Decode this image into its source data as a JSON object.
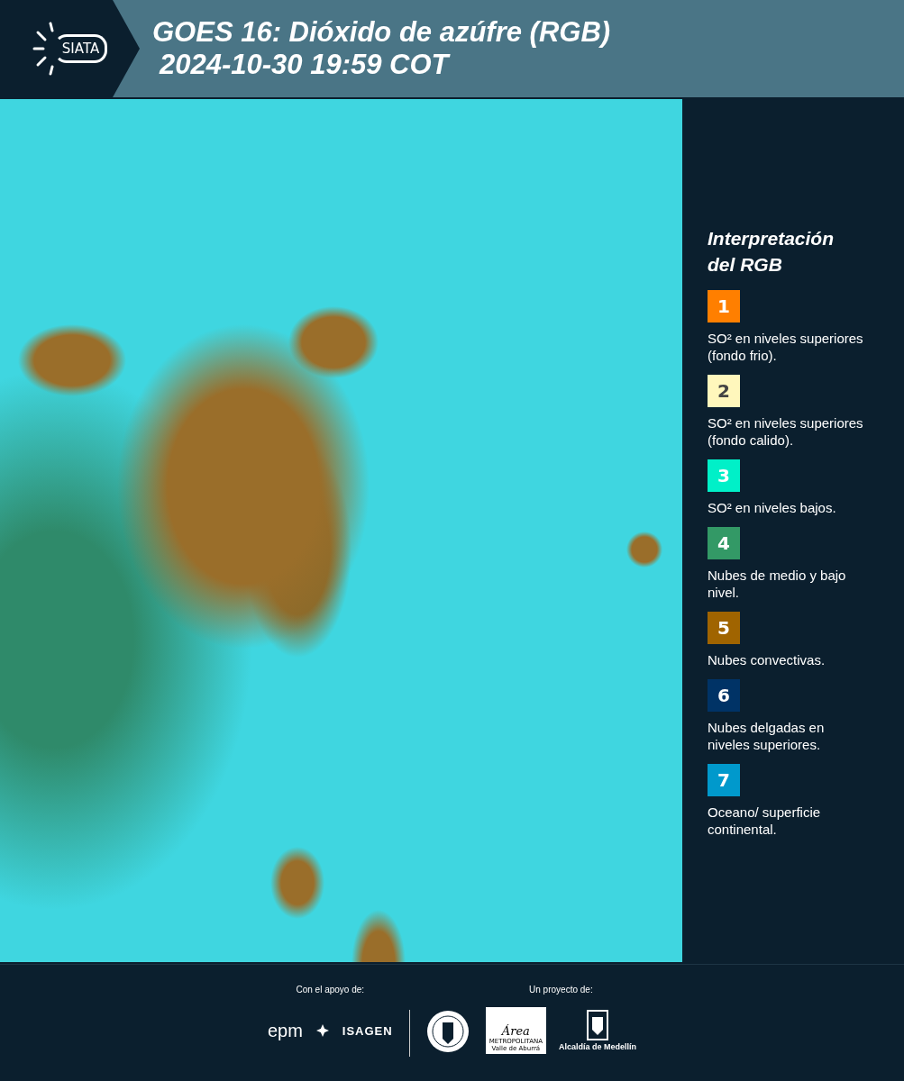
{
  "header": {
    "logo_text": "SIATA",
    "title": "GOES 16: Dióxido de azúfre (RGB)",
    "timestamp": "2024-10-30 19:59 COT"
  },
  "legend": {
    "title_line_1": "Interpretación",
    "title_line_2": "del RGB",
    "items": [
      {
        "number": "1",
        "color": "#ff7f00",
        "text": "SO² en niveles superiores (fondo frio)."
      },
      {
        "number": "2",
        "color": "#fff7bc",
        "text": "SO² en niveles superiores (fondo calido)."
      },
      {
        "number": "3",
        "color": "#00f0c8",
        "text": "SO² en niveles bajos."
      },
      {
        "number": "4",
        "color": "#339966",
        "text": "Nubes de medio y bajo nivel."
      },
      {
        "number": "5",
        "color": "#a06400",
        "text": "Nubes convectivas."
      },
      {
        "number": "6",
        "color": "#003366",
        "text": "Nubes delgadas en niveles superiores."
      },
      {
        "number": "7",
        "color": "#0099cc",
        "text": "Oceano/ superficie continental."
      }
    ]
  },
  "footer": {
    "support_label": "Con el apoyo de:",
    "project_label": "Un proyecto de:",
    "epm": "epm",
    "isagen": "ISAGEN",
    "area_script": "Área",
    "area_name": "METROPOLITANA",
    "area_region": "Valle de Aburrá",
    "alcaldia": "Alcaldía de Medellín"
  }
}
